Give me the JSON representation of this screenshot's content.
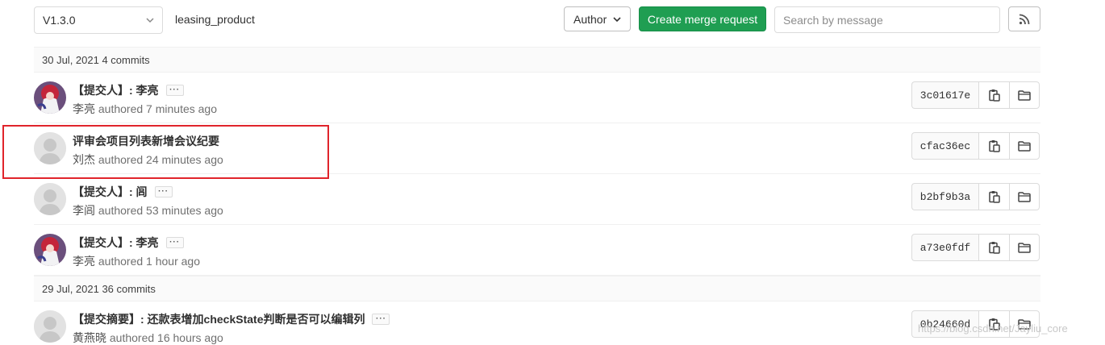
{
  "toolbar": {
    "branch": "V1.3.0",
    "path": "leasing_product",
    "author_label": "Author",
    "merge_label": "Create merge request",
    "search_placeholder": "Search by message"
  },
  "days": [
    {
      "label": "30 Jul, 2021 4 commits"
    },
    {
      "label": "29 Jul, 2021 36 commits"
    }
  ],
  "commits": [
    {
      "title": "【提交人】: 李亮",
      "author": "李亮",
      "meta": "authored 7 minutes ago",
      "sha": "3c01617e",
      "avatar": "anime-avatar-icon",
      "has_ellipsis": true
    },
    {
      "title": "评审会项目列表新增会议纪要",
      "author": "刘杰",
      "meta": "authored 24 minutes ago",
      "sha": "cfac36ec",
      "avatar": "default-avatar-icon",
      "has_ellipsis": false
    },
    {
      "title": "【提交人】: 闾",
      "author": "李闾",
      "meta": "authored 53 minutes ago",
      "sha": "b2bf9b3a",
      "avatar": "default-avatar-icon",
      "has_ellipsis": true
    },
    {
      "title": "【提交人】: 李亮",
      "author": "李亮",
      "meta": "authored 1 hour ago",
      "sha": "a73e0fdf",
      "avatar": "anime-avatar-icon",
      "has_ellipsis": true
    },
    {
      "title": "【提交摘要】: 还款表增加checkState判断是否可以编辑列",
      "author": "黄燕晓",
      "meta": "authored 16 hours ago",
      "sha": "0b24660d",
      "avatar": "default-avatar-icon",
      "has_ellipsis": true
    }
  ],
  "watermark": "https://blog.csdn.net/Jayliu_core",
  "colors": {
    "primary_green": "#1f9e52",
    "highlight_red": "#e0242b"
  }
}
